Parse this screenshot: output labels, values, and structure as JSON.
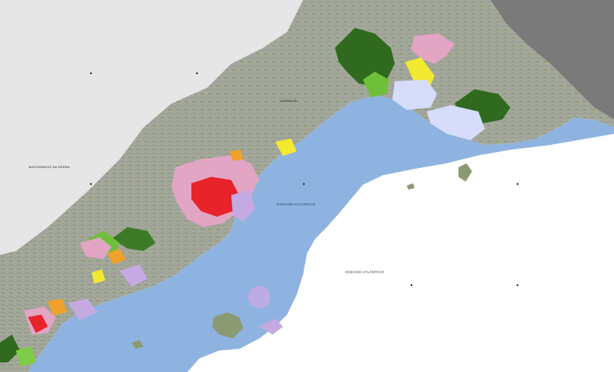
{
  "map": {
    "region_labels": {
      "interior": "MATOSINHOS DA SERRA",
      "ocean_bay": "OCEANO ATLÂNTICO",
      "ocean_open": "OCEANO ATLÂNTICO",
      "north_town": "CARAGUÁ"
    },
    "colors": {
      "ocean": "#8fb3e0",
      "open_sea": "#ffffff",
      "outside_area": "#e6e6e6",
      "dark_outside": "#7a7a7a",
      "terrain": "#a4a79b",
      "forest_dark": "#2f6a1e",
      "forest_light": "#6fbf3a",
      "urban_red": "#e8232a",
      "urban_pink": "#e2a5c3",
      "industrial_yellow": "#f2e930",
      "orange": "#f0a12a",
      "lilac": "#c5a9e3",
      "pale_blue_zone": "#d6dcfa"
    }
  }
}
